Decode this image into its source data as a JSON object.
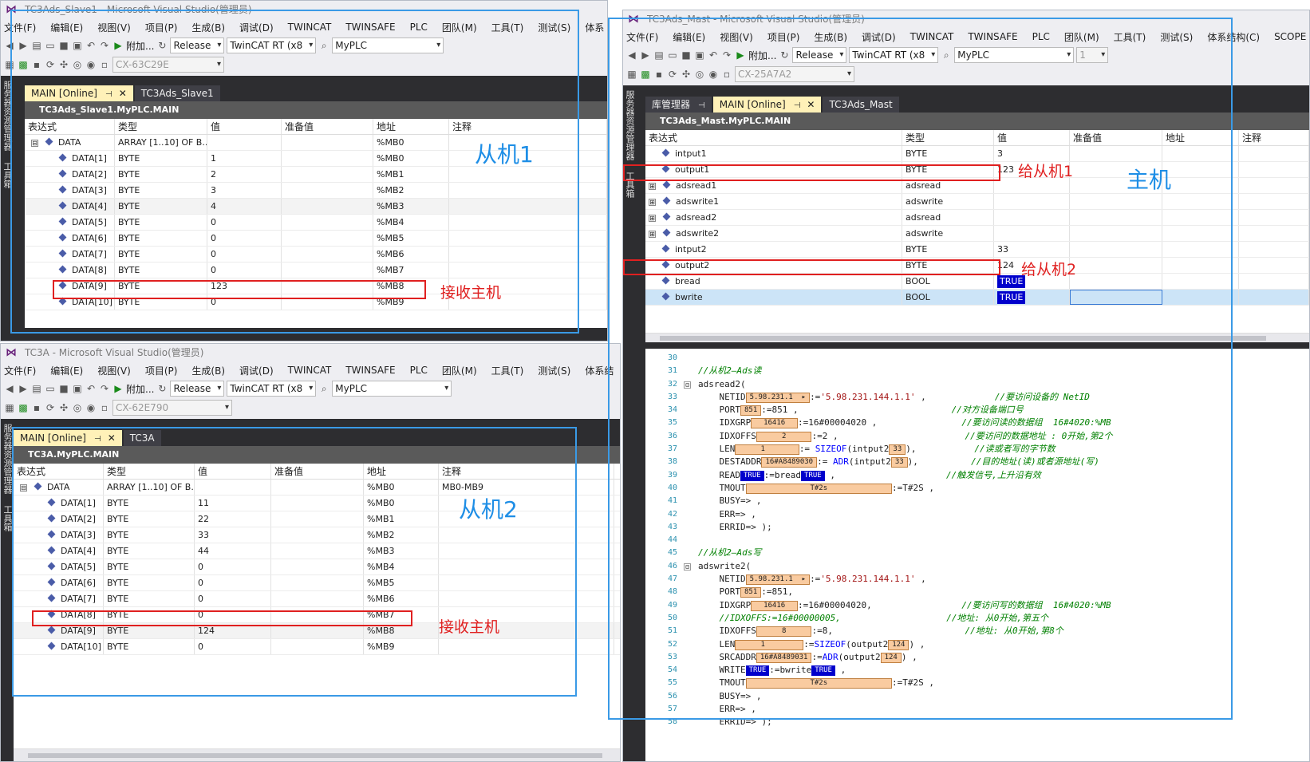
{
  "slave1_window": {
    "title": "TC3Ads_Slave1 - Microsoft Visual Studio(管理员)",
    "menu": [
      "文件(F)",
      "编辑(E)",
      "视图(V)",
      "项目(P)",
      "生成(B)",
      "调试(D)",
      "TWINCAT",
      "TWINSAFE",
      "PLC",
      "团队(M)",
      "工具(T)",
      "测试(S)",
      "体系"
    ],
    "toolbar": {
      "attach": "附加...",
      "config": "Release",
      "platform": "TwinCAT RT (x8",
      "project": "MyPLC",
      "target": "CX-63C29E"
    },
    "side_labels": [
      "服务器资源管理器",
      "工具箱"
    ],
    "tabs": [
      {
        "label": "MAIN [Online]",
        "active": true
      },
      {
        "label": "TC3Ads_Slave1",
        "active": false
      }
    ],
    "path": "TC3Ads_Slave1.MyPLC.MAIN",
    "columns": [
      "表达式",
      "类型",
      "值",
      "准备值",
      "地址",
      "注释"
    ],
    "rows": [
      {
        "expr": "DATA",
        "type": "ARRAY [1..10] OF B...",
        "value": "",
        "addr": "%MB0",
        "expand": "⊟"
      },
      {
        "expr": "DATA[1]",
        "type": "BYTE",
        "value": "1",
        "addr": "%MB0"
      },
      {
        "expr": "DATA[2]",
        "type": "BYTE",
        "value": "2",
        "addr": "%MB1"
      },
      {
        "expr": "DATA[3]",
        "type": "BYTE",
        "value": "3",
        "addr": "%MB2"
      },
      {
        "expr": "DATA[4]",
        "type": "BYTE",
        "value": "4",
        "addr": "%MB3"
      },
      {
        "expr": "DATA[5]",
        "type": "BYTE",
        "value": "0",
        "addr": "%MB4"
      },
      {
        "expr": "DATA[6]",
        "type": "BYTE",
        "value": "0",
        "addr": "%MB5"
      },
      {
        "expr": "DATA[7]",
        "type": "BYTE",
        "value": "0",
        "addr": "%MB6"
      },
      {
        "expr": "DATA[8]",
        "type": "BYTE",
        "value": "0",
        "addr": "%MB7"
      },
      {
        "expr": "DATA[9]",
        "type": "BYTE",
        "value": "123",
        "addr": "%MB8"
      },
      {
        "expr": "DATA[10]",
        "type": "BYTE",
        "value": "0",
        "addr": "%MB9"
      }
    ]
  },
  "slave2_window": {
    "title": "TC3A - Microsoft Visual Studio(管理员)",
    "menu": [
      "文件(F)",
      "编辑(E)",
      "视图(V)",
      "项目(P)",
      "生成(B)",
      "调试(D)",
      "TWINCAT",
      "TWINSAFE",
      "PLC",
      "团队(M)",
      "工具(T)",
      "测试(S)",
      "体系结"
    ],
    "toolbar": {
      "attach": "附加...",
      "config": "Release",
      "platform": "TwinCAT RT (x8",
      "project": "MyPLC",
      "target": "CX-62E790"
    },
    "side_labels": [
      "服务器资源管理器",
      "工具箱"
    ],
    "tabs": [
      {
        "label": "MAIN [Online]",
        "active": true
      },
      {
        "label": "TC3A",
        "active": false
      }
    ],
    "path": "TC3A.MyPLC.MAIN",
    "columns": [
      "表达式",
      "类型",
      "值",
      "准备值",
      "地址",
      "注释"
    ],
    "rows": [
      {
        "expr": "DATA",
        "type": "ARRAY [1..10] OF B...",
        "value": "",
        "addr": "%MB0",
        "comment": "MB0-MB9",
        "expand": "⊟"
      },
      {
        "expr": "DATA[1]",
        "type": "BYTE",
        "value": "11",
        "addr": "%MB0"
      },
      {
        "expr": "DATA[2]",
        "type": "BYTE",
        "value": "22",
        "addr": "%MB1"
      },
      {
        "expr": "DATA[3]",
        "type": "BYTE",
        "value": "33",
        "addr": "%MB2"
      },
      {
        "expr": "DATA[4]",
        "type": "BYTE",
        "value": "44",
        "addr": "%MB3"
      },
      {
        "expr": "DATA[5]",
        "type": "BYTE",
        "value": "0",
        "addr": "%MB4"
      },
      {
        "expr": "DATA[6]",
        "type": "BYTE",
        "value": "0",
        "addr": "%MB5"
      },
      {
        "expr": "DATA[7]",
        "type": "BYTE",
        "value": "0",
        "addr": "%MB6"
      },
      {
        "expr": "DATA[8]",
        "type": "BYTE",
        "value": "0",
        "addr": "%MB7"
      },
      {
        "expr": "DATA[9]",
        "type": "BYTE",
        "value": "124",
        "addr": "%MB8"
      },
      {
        "expr": "DATA[10]",
        "type": "BYTE",
        "value": "0",
        "addr": "%MB9"
      }
    ]
  },
  "master_window": {
    "title": "TC3Ads_Mast - Microsoft Visual Studio(管理员)",
    "menu": [
      "文件(F)",
      "编辑(E)",
      "视图(V)",
      "项目(P)",
      "生成(B)",
      "调试(D)",
      "TWINCAT",
      "TWINSAFE",
      "PLC",
      "团队(M)",
      "工具(T)",
      "测试(S)",
      "体系结构(C)",
      "SCOPE"
    ],
    "toolbar": {
      "attach": "附加...",
      "config": "Release",
      "platform": "TwinCAT RT (x8",
      "project": "MyPLC",
      "target": "CX-25A7A2",
      "extra": "1"
    },
    "side_labels": [
      "服务器资源管理器",
      "工具箱"
    ],
    "tabs": [
      {
        "label": "库管理器",
        "active": false
      },
      {
        "label": "MAIN [Online]",
        "active": true
      },
      {
        "label": "TC3Ads_Mast",
        "active": false
      }
    ],
    "path": "TC3Ads_Mast.MyPLC.MAIN",
    "columns": [
      "表达式",
      "类型",
      "值",
      "准备值",
      "地址",
      "注释"
    ],
    "rows": [
      {
        "expr": "intput1",
        "type": "BYTE",
        "value": "3"
      },
      {
        "expr": "output1",
        "type": "BYTE",
        "value": "123"
      },
      {
        "expr": "adsread1",
        "type": "adsread",
        "value": "",
        "expand": "⊞"
      },
      {
        "expr": "adswrite1",
        "type": "adswrite",
        "value": "",
        "expand": "⊞"
      },
      {
        "expr": "adsread2",
        "type": "adsread",
        "value": "",
        "expand": "⊞"
      },
      {
        "expr": "adswrite2",
        "type": "adswrite",
        "value": "",
        "expand": "⊞"
      },
      {
        "expr": "intput2",
        "type": "BYTE",
        "value": "33"
      },
      {
        "expr": "output2",
        "type": "BYTE",
        "value": "124"
      },
      {
        "expr": "bread",
        "type": "BOOL",
        "value": "TRUE",
        "bool": true
      },
      {
        "expr": "bwrite",
        "type": "BOOL",
        "value": "TRUE",
        "bool": true,
        "selected": true
      }
    ],
    "code": [
      {
        "n": "30",
        "html": ""
      },
      {
        "n": "31",
        "html": "<span class='cm'>//从机2—Ads读</span>"
      },
      {
        "n": "32",
        "fold": "⊟",
        "html": "adsread2("
      },
      {
        "n": "33",
        "html": "&nbsp;&nbsp;&nbsp;&nbsp;NETID<span class='mon'>5.98.231.1&nbsp;&nbsp;▸</span>:=<span class='str'>'5.98.231.144.1.1'</span> ,&nbsp;&nbsp;&nbsp;&nbsp;&nbsp;&nbsp;&nbsp;&nbsp;&nbsp;&nbsp;&nbsp;&nbsp;&nbsp;<span class='cm'>//要访问设备的 NetID</span>"
      },
      {
        "n": "34",
        "html": "&nbsp;&nbsp;&nbsp;&nbsp;PORT<span class='mon'>851</span>:=851 ,&nbsp;&nbsp;&nbsp;&nbsp;&nbsp;&nbsp;&nbsp;&nbsp;&nbsp;&nbsp;&nbsp;&nbsp;&nbsp;&nbsp;&nbsp;&nbsp;&nbsp;&nbsp;&nbsp;&nbsp;&nbsp;&nbsp;&nbsp;&nbsp;&nbsp;&nbsp;&nbsp;&nbsp;&nbsp;<span class='cm'>//对方设备端口号</span>"
      },
      {
        "n": "35",
        "html": "&nbsp;&nbsp;&nbsp;&nbsp;IDXGRP<span class='mon'>&nbsp;&nbsp;16416&nbsp;&nbsp;</span>:=16#00004020 ,&nbsp;&nbsp;&nbsp;&nbsp;&nbsp;&nbsp;&nbsp;&nbsp;&nbsp;&nbsp;&nbsp;&nbsp;&nbsp;&nbsp;&nbsp;&nbsp;<span class='cm'>//要访问读的数据组&nbsp;&nbsp;16#4020:%MB</span>"
      },
      {
        "n": "36",
        "html": "&nbsp;&nbsp;&nbsp;&nbsp;IDXOFFS<span class='mon'>&nbsp;&nbsp;&nbsp;&nbsp;&nbsp;2&nbsp;&nbsp;&nbsp;&nbsp;&nbsp;</span>:=2 ,&nbsp;&nbsp;&nbsp;&nbsp;&nbsp;&nbsp;&nbsp;&nbsp;&nbsp;&nbsp;&nbsp;&nbsp;&nbsp;&nbsp;&nbsp;&nbsp;&nbsp;&nbsp;&nbsp;&nbsp;&nbsp;&nbsp;&nbsp;&nbsp;<span class='cm'>//要访问的数据地址 : 0开始,第2个</span>"
      },
      {
        "n": "37",
        "html": "&nbsp;&nbsp;&nbsp;&nbsp;LEN<span class='mon'>&nbsp;&nbsp;&nbsp;&nbsp;&nbsp;1&nbsp;&nbsp;&nbsp;&nbsp;&nbsp;&nbsp;&nbsp;</span>:= <span class='kw'>SIZEOF</span>(intput2<span class='mon'>33</span>),&nbsp;&nbsp;&nbsp;&nbsp;&nbsp;&nbsp;&nbsp;&nbsp;&nbsp;&nbsp;&nbsp;<span class='cm'>//读或者写的字节数</span>"
      },
      {
        "n": "38",
        "html": "&nbsp;&nbsp;&nbsp;&nbsp;DESTADDR<span class='mon'>16#A8489030</span>:= <span class='kw'>ADR</span>(intput2<span class='mon'>33</span>),&nbsp;&nbsp;&nbsp;&nbsp;&nbsp;&nbsp;&nbsp;&nbsp;&nbsp;&nbsp;<span class='cm'>//目的地址(读)或者源地址(写)</span>"
      },
      {
        "n": "39",
        "html": "&nbsp;&nbsp;&nbsp;&nbsp;READ<span class='mon tv'>TRUE</span>:=bread<span class='mon tv'>TRUE</span> ,&nbsp;&nbsp;&nbsp;&nbsp;&nbsp;&nbsp;&nbsp;&nbsp;&nbsp;&nbsp;&nbsp;&nbsp;&nbsp;&nbsp;&nbsp;&nbsp;&nbsp;&nbsp;&nbsp;&nbsp;&nbsp;<span class='cm'>//触发信号,上升沿有效</span>"
      },
      {
        "n": "40",
        "html": "&nbsp;&nbsp;&nbsp;&nbsp;TMOUT<span class='mon'>&nbsp;&nbsp;&nbsp;&nbsp;&nbsp;&nbsp;&nbsp;&nbsp;&nbsp;&nbsp;&nbsp;&nbsp;&nbsp;&nbsp;T#2s&nbsp;&nbsp;&nbsp;&nbsp;&nbsp;&nbsp;&nbsp;&nbsp;&nbsp;&nbsp;&nbsp;&nbsp;&nbsp;&nbsp;</span>:=T#2S ,"
      },
      {
        "n": "41",
        "html": "&nbsp;&nbsp;&nbsp;&nbsp;BUSY=> ,"
      },
      {
        "n": "42",
        "html": "&nbsp;&nbsp;&nbsp;&nbsp;ERR=> ,"
      },
      {
        "n": "43",
        "html": "&nbsp;&nbsp;&nbsp;&nbsp;ERRID=> );"
      },
      {
        "n": "44",
        "html": ""
      },
      {
        "n": "45",
        "html": "<span class='cm'>//从机2—Ads写</span>"
      },
      {
        "n": "46",
        "fold": "⊟",
        "html": "adswrite2("
      },
      {
        "n": "47",
        "html": "&nbsp;&nbsp;&nbsp;&nbsp;NETID<span class='mon'>5.98.231.1&nbsp;&nbsp;▸</span>:=<span class='str'>'5.98.231.144.1.1'</span> ,"
      },
      {
        "n": "48",
        "html": "&nbsp;&nbsp;&nbsp;&nbsp;PORT<span class='mon'>851</span>:=851,"
      },
      {
        "n": "49",
        "html": "&nbsp;&nbsp;&nbsp;&nbsp;IDXGRP<span class='mon'>&nbsp;&nbsp;16416&nbsp;&nbsp;</span>:=16#00004020,&nbsp;&nbsp;&nbsp;&nbsp;&nbsp;&nbsp;&nbsp;&nbsp;&nbsp;&nbsp;&nbsp;&nbsp;&nbsp;&nbsp;&nbsp;&nbsp;&nbsp;<span class='cm'>//要访问写的数据组&nbsp;&nbsp;16#4020:%MB</span>"
      },
      {
        "n": "50",
        "html": "&nbsp;&nbsp;&nbsp;&nbsp;<span class='cm'>//IDXOFFS:=16#00000005,&nbsp;&nbsp;&nbsp;&nbsp;&nbsp;&nbsp;&nbsp;&nbsp;&nbsp;&nbsp;&nbsp;&nbsp;&nbsp;&nbsp;&nbsp;&nbsp;&nbsp;&nbsp;&nbsp;&nbsp;//地址: 从0开始,第五个</span>"
      },
      {
        "n": "51",
        "html": "&nbsp;&nbsp;&nbsp;&nbsp;IDXOFFS<span class='mon'>&nbsp;&nbsp;&nbsp;&nbsp;&nbsp;8&nbsp;&nbsp;&nbsp;&nbsp;&nbsp;</span>:=8,&nbsp;&nbsp;&nbsp;&nbsp;&nbsp;&nbsp;&nbsp;&nbsp;&nbsp;&nbsp;&nbsp;&nbsp;&nbsp;&nbsp;&nbsp;&nbsp;&nbsp;&nbsp;&nbsp;&nbsp;&nbsp;&nbsp;&nbsp;&nbsp;&nbsp;<span class='cm'>//地址: 从0开始,第8个</span>"
      },
      {
        "n": "52",
        "html": "&nbsp;&nbsp;&nbsp;&nbsp;LEN<span class='mon'>&nbsp;&nbsp;&nbsp;&nbsp;&nbsp;1&nbsp;&nbsp;&nbsp;&nbsp;&nbsp;&nbsp;&nbsp;&nbsp;</span>:=<span class='kw'>SIZEOF</span>(output2<span class='mon'>124</span>) ,"
      },
      {
        "n": "53",
        "html": "&nbsp;&nbsp;&nbsp;&nbsp;SRCADDR<span class='mon'>16#A8489031</span>:=<span class='kw'>ADR</span>(output2<span class='mon'>124</span>) ,"
      },
      {
        "n": "54",
        "html": "&nbsp;&nbsp;&nbsp;&nbsp;WRITE<span class='mon tv'>TRUE</span>:=bwrite<span class='mon tv'>TRUE</span> ,"
      },
      {
        "n": "55",
        "html": "&nbsp;&nbsp;&nbsp;&nbsp;TMOUT<span class='mon'>&nbsp;&nbsp;&nbsp;&nbsp;&nbsp;&nbsp;&nbsp;&nbsp;&nbsp;&nbsp;&nbsp;&nbsp;&nbsp;&nbsp;T#2s&nbsp;&nbsp;&nbsp;&nbsp;&nbsp;&nbsp;&nbsp;&nbsp;&nbsp;&nbsp;&nbsp;&nbsp;&nbsp;&nbsp;</span>:=T#2S ,"
      },
      {
        "n": "56",
        "html": "&nbsp;&nbsp;&nbsp;&nbsp;BUSY=> ,"
      },
      {
        "n": "57",
        "html": "&nbsp;&nbsp;&nbsp;&nbsp;ERR=> ,"
      },
      {
        "n": "58",
        "html": "&nbsp;&nbsp;&nbsp;&nbsp;ERRID=> );"
      }
    ]
  },
  "annotations": {
    "slave1_label": "从机1",
    "slave2_label": "从机2",
    "master_label": "主机",
    "slave1_receive": "接收主机",
    "slave2_receive": "接收主机",
    "to_slave1": "给从机1",
    "to_slave2": "给从机2"
  },
  "colors": {
    "annotation_blue": "#3a9ae6",
    "annotation_red": "#e02020",
    "true_bg": "#0000cc",
    "active_tab": "#fff1b8"
  }
}
